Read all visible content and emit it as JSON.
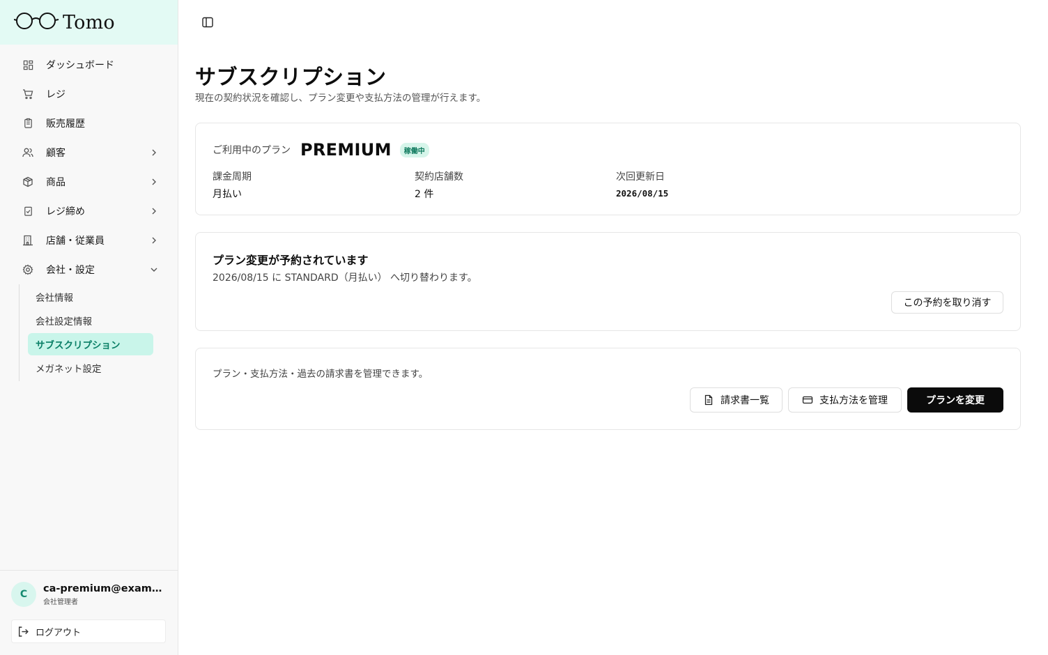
{
  "brand": {
    "name": "Tomo",
    "accent": "#e3faf4"
  },
  "sidebar": {
    "items": [
      {
        "label": "ダッシュボード",
        "icon": "dashboard-icon",
        "has_chevron": false
      },
      {
        "label": "レジ",
        "icon": "cart-icon",
        "has_chevron": false
      },
      {
        "label": "販売履歴",
        "icon": "receipt-icon",
        "has_chevron": false
      },
      {
        "label": "顧客",
        "icon": "users-icon",
        "has_chevron": true
      },
      {
        "label": "商品",
        "icon": "package-icon",
        "has_chevron": true
      },
      {
        "label": "レジ締め",
        "icon": "clipboard-check-icon",
        "has_chevron": true
      },
      {
        "label": "店舗・従業員",
        "icon": "building-icon",
        "has_chevron": true
      },
      {
        "label": "会社・設定",
        "icon": "gear-icon",
        "has_chevron": true,
        "expanded": true
      }
    ],
    "subitems": [
      {
        "label": "会社情報"
      },
      {
        "label": "会社設定情報"
      },
      {
        "label": "サブスクリプション",
        "active": true
      },
      {
        "label": "メガネット設定"
      }
    ]
  },
  "user": {
    "initial": "C",
    "email": "ca-premium@example.com",
    "role": "会社管理者",
    "logout_label": "ログアウト"
  },
  "page": {
    "title": "サブスクリプション",
    "subtitle": "現在の契約状況を確認し、プラン変更や支払方法の管理が行えます。"
  },
  "plan": {
    "label": "ご利用中のプラン",
    "name": "PREMIUM",
    "status": "稼働中",
    "billing_cycle_label": "課金周期",
    "billing_cycle": "月払い",
    "stores_label": "契約店舗数",
    "stores": "2 件",
    "next_renewal_label": "次回更新日",
    "next_renewal": "2026/08/15"
  },
  "scheduled_change": {
    "title": "プラン変更が予約されています",
    "text": "2026/08/15 に STANDARD（月払い） へ切り替わります。",
    "cancel_label": "この予約を取り消す"
  },
  "manage": {
    "text": "プラン・支払方法・過去の請求書を管理できます。",
    "invoices_label": "請求書一覧",
    "payment_label": "支払方法を管理",
    "change_plan_label": "プランを変更"
  }
}
